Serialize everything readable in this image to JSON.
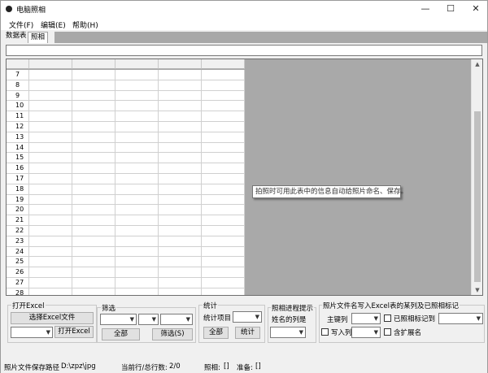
{
  "window": {
    "title": "电脑照相",
    "minimize_glyph": "—",
    "maximize_glyph": "☐",
    "close_glyph": "✕"
  },
  "menu": [
    "文件(F)",
    "编辑(E)",
    "帮助(H)"
  ],
  "tabs": [
    "数据表",
    "照相"
  ],
  "grid": {
    "row_numbers": [
      "7",
      "8",
      "9",
      "10",
      "11",
      "12",
      "13",
      "14",
      "15",
      "16",
      "17",
      "18",
      "19",
      "20",
      "21",
      "22",
      "23",
      "24",
      "25",
      "26",
      "27",
      "28"
    ],
    "tooltip": "拍照时可用此表中的信息自动给照片命名、保存。"
  },
  "panel": {
    "open_excel": {
      "title": "打开Excel",
      "select_button": "选择Excel文件",
      "open_button": "打开Excel"
    },
    "filter": {
      "title": "筛选",
      "all_button": "全部",
      "filter_button": "筛选(S)"
    },
    "stats": {
      "title": "统计",
      "item_label": "统计项目",
      "all_button": "全部",
      "stat_button": "统计"
    },
    "progress": {
      "title": "照相进程提示",
      "name_col_label": "姓名的列是"
    },
    "write": {
      "title": "照片文件名写入Excel表的某列及已照相标记",
      "primary_key_label": "主键列",
      "marked_label": "已照相标记到",
      "write_col_label": "写入列",
      "with_ext_label": "含扩展名"
    }
  },
  "status": {
    "save_path_label": "照片文件保存路径",
    "save_path_value": "D:\\zpz\\jpg",
    "row_label": "当前行/总行数:",
    "row_value": "2/0",
    "photo_label": "照相:",
    "photo_value": "[]",
    "ready_label": "准备:",
    "ready_value": "[]"
  }
}
